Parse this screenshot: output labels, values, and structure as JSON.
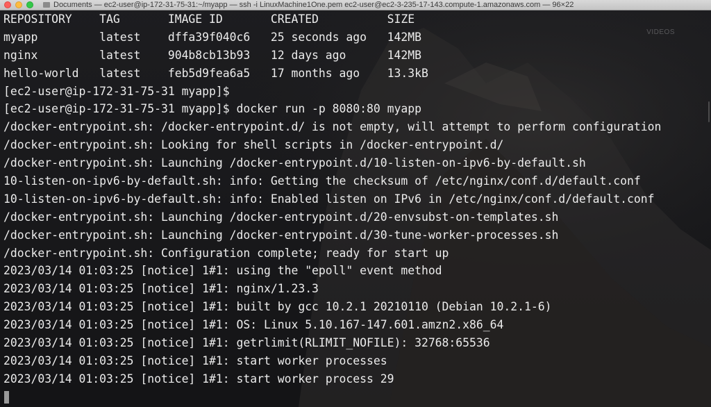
{
  "window": {
    "title": "Documents — ec2-user@ip-172-31-75-31:~/myapp — ssh -i LinuxMachine1One.pem ec2-user@ec2-3-235-17-143.compute-1.amazonaws.com — 96×22"
  },
  "overlay": {
    "watermark": "VIDEOS"
  },
  "terminal": {
    "lines": [
      "REPOSITORY    TAG       IMAGE ID       CREATED          SIZE",
      "myapp         latest    dffa39f040c6   25 seconds ago   142MB",
      "nginx         latest    904b8cb13b93   12 days ago      142MB",
      "hello-world   latest    feb5d9fea6a5   17 months ago    13.3kB",
      "[ec2-user@ip-172-31-75-31 myapp]$",
      "[ec2-user@ip-172-31-75-31 myapp]$ docker run -p 8080:80 myapp",
      "/docker-entrypoint.sh: /docker-entrypoint.d/ is not empty, will attempt to perform configuration",
      "/docker-entrypoint.sh: Looking for shell scripts in /docker-entrypoint.d/",
      "/docker-entrypoint.sh: Launching /docker-entrypoint.d/10-listen-on-ipv6-by-default.sh",
      "10-listen-on-ipv6-by-default.sh: info: Getting the checksum of /etc/nginx/conf.d/default.conf",
      "10-listen-on-ipv6-by-default.sh: info: Enabled listen on IPv6 in /etc/nginx/conf.d/default.conf",
      "/docker-entrypoint.sh: Launching /docker-entrypoint.d/20-envsubst-on-templates.sh",
      "/docker-entrypoint.sh: Launching /docker-entrypoint.d/30-tune-worker-processes.sh",
      "/docker-entrypoint.sh: Configuration complete; ready for start up",
      "2023/03/14 01:03:25 [notice] 1#1: using the \"epoll\" event method",
      "2023/03/14 01:03:25 [notice] 1#1: nginx/1.23.3",
      "2023/03/14 01:03:25 [notice] 1#1: built by gcc 10.2.1 20210110 (Debian 10.2.1-6)",
      "2023/03/14 01:03:25 [notice] 1#1: OS: Linux 5.10.167-147.601.amzn2.x86_64",
      "2023/03/14 01:03:25 [notice] 1#1: getrlimit(RLIMIT_NOFILE): 32768:65536",
      "2023/03/14 01:03:25 [notice] 1#1: start worker processes",
      "2023/03/14 01:03:25 [notice] 1#1: start worker process 29"
    ]
  },
  "colors": {
    "text": "#ececec",
    "background": "#1b1b1d",
    "titlebar": "#d0d0d0"
  },
  "icons": {
    "close": "close-icon",
    "minimize": "minimize-icon",
    "maximize": "maximize-icon",
    "folder": "folder-icon"
  }
}
